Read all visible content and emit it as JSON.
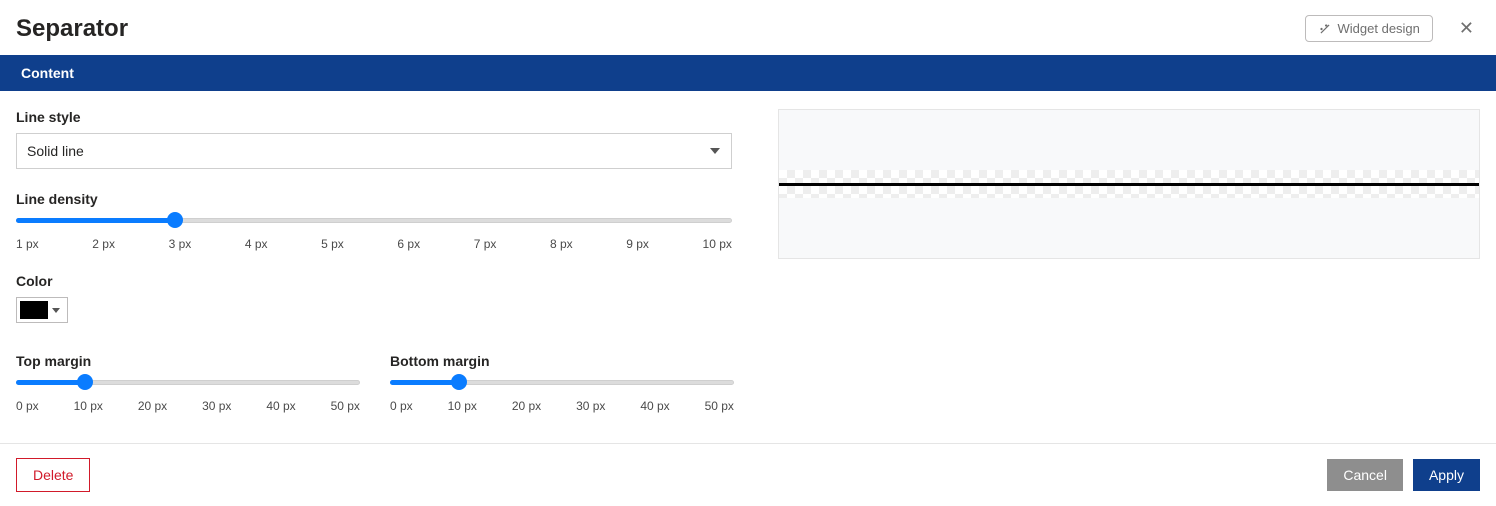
{
  "header": {
    "title": "Separator",
    "widget_design_label": "Widget design"
  },
  "section": {
    "content_label": "Content"
  },
  "form": {
    "line_style": {
      "label": "Line style",
      "value": "Solid line"
    },
    "line_density": {
      "label": "Line density",
      "value_index": 2,
      "value_px": "3 px",
      "ticks": [
        "1 px",
        "2 px",
        "3 px",
        "4 px",
        "5 px",
        "6 px",
        "7 px",
        "8 px",
        "9 px",
        "10 px"
      ]
    },
    "color": {
      "label": "Color",
      "value": "#000000"
    },
    "top_margin": {
      "label": "Top margin",
      "value_index": 1,
      "value_px": "10 px",
      "ticks": [
        "0 px",
        "10 px",
        "20 px",
        "30 px",
        "40 px",
        "50 px"
      ]
    },
    "bottom_margin": {
      "label": "Bottom margin",
      "value_index": 1,
      "value_px": "10 px",
      "ticks": [
        "0 px",
        "10 px",
        "20 px",
        "30 px",
        "40 px",
        "50 px"
      ]
    }
  },
  "footer": {
    "delete_label": "Delete",
    "cancel_label": "Cancel",
    "apply_label": "Apply"
  }
}
